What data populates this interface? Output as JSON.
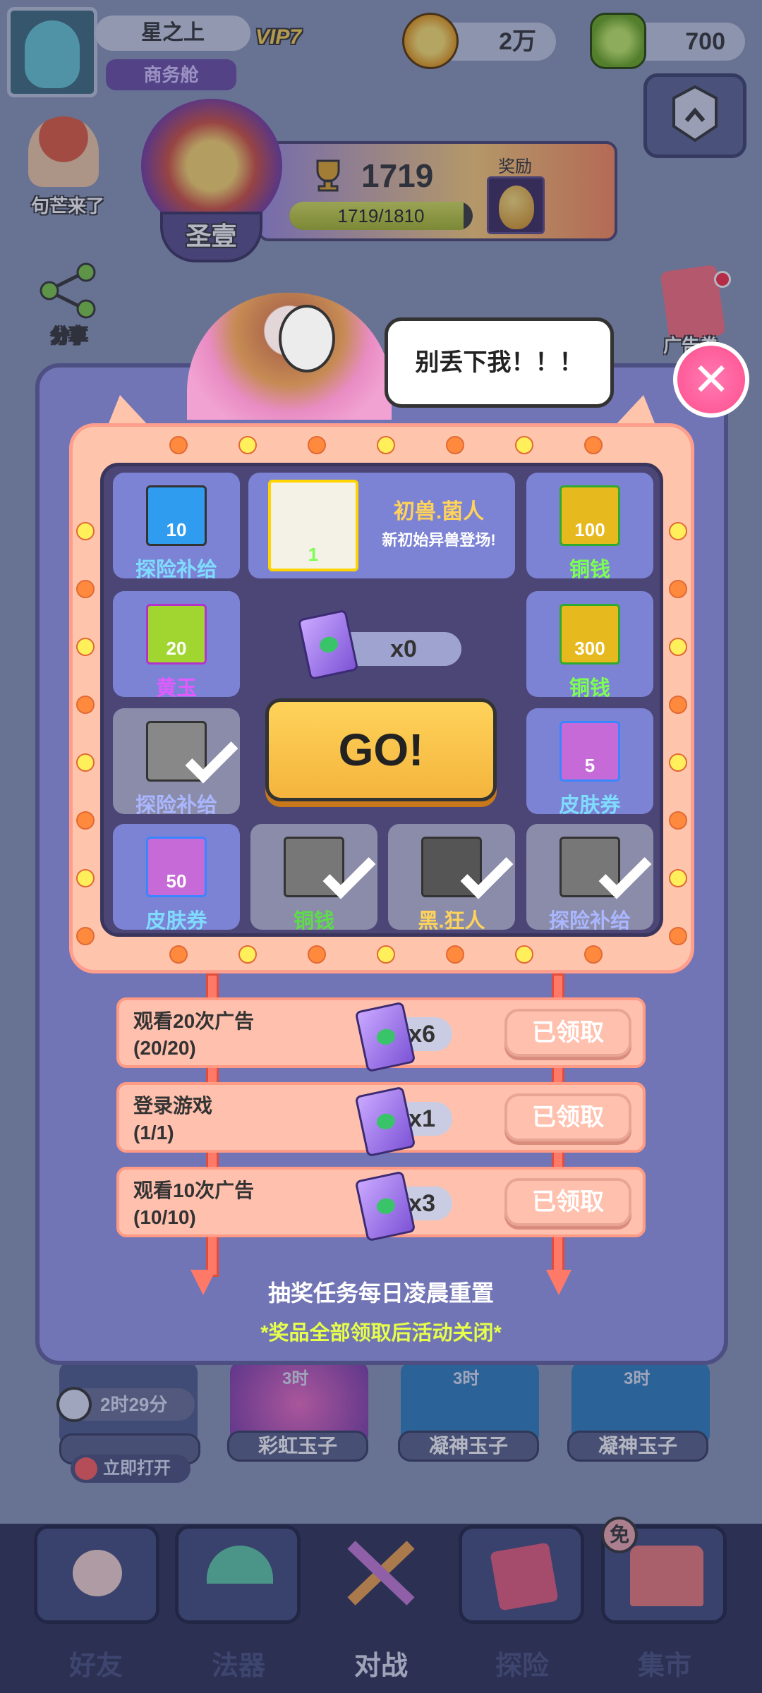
{
  "player": {
    "name": "星之上",
    "vip": "VIP7",
    "title": "商务舱"
  },
  "resources": {
    "coins": "2万",
    "jade": "700"
  },
  "rank": {
    "score": "1719",
    "progress_text": "1719/1810",
    "progress_fraction": 0.95,
    "reward_label": "奖励",
    "rank_name": "圣壹"
  },
  "side_left": [
    {
      "label": "句芒来了"
    },
    {
      "label": "分享"
    }
  ],
  "side_right": {
    "label": "广告卷"
  },
  "speech": "别丢下我！！！",
  "board": {
    "featured": {
      "name": "初兽.菌人",
      "desc": "新初始异兽登场!",
      "count": "1"
    },
    "tickets": "x0",
    "go_label": "GO!",
    "cells": [
      {
        "label": "探险补给",
        "count": "10",
        "claimed": false,
        "color": "#2f9cf0"
      },
      {
        "label": "铜钱",
        "count": "100",
        "claimed": false,
        "color": "#e6b91f"
      },
      {
        "label": "黄玉",
        "count": "20",
        "claimed": false,
        "color": "#a1d630"
      },
      {
        "label": "铜钱",
        "count": "300",
        "claimed": false,
        "color": "#e6b91f"
      },
      {
        "label": "探险补给",
        "count": "",
        "claimed": true,
        "color": "#888888"
      },
      {
        "label": "皮肤券",
        "count": "5",
        "claimed": false,
        "color": "#c66ad7"
      },
      {
        "label": "皮肤券",
        "count": "50",
        "claimed": false,
        "color": "#c66ad7"
      },
      {
        "label": "铜钱",
        "count": "",
        "claimed": true,
        "color": "#888888"
      },
      {
        "label": "黑.狂人",
        "count": "",
        "claimed": true,
        "color": "#666666"
      },
      {
        "label": "探险补给",
        "count": "",
        "claimed": true,
        "color": "#888888"
      }
    ]
  },
  "tasks": [
    {
      "title": "观看20次广告",
      "progress": "(20/20)",
      "reward": "x6",
      "button": "已领取"
    },
    {
      "title": "登录游戏",
      "progress": "(1/1)",
      "reward": "x1",
      "button": "已领取"
    },
    {
      "title": "观看10次广告",
      "progress": "(10/10)",
      "reward": "x3",
      "button": "已领取"
    }
  ],
  "footer": {
    "note": "抽奖任务每日凌晨重置",
    "warning": "*奖品全部领取后活动关闭*"
  },
  "eggs": {
    "timer": "2时29分",
    "open_now": "立即打开",
    "slots": [
      {
        "label": "彩虹玉子",
        "time": "3时"
      },
      {
        "label": "凝神玉子",
        "time": "3时"
      },
      {
        "label": "凝神玉子",
        "time": "3时"
      }
    ]
  },
  "nav": [
    {
      "label": "好友"
    },
    {
      "label": "法器"
    },
    {
      "label": "对战"
    },
    {
      "label": "探险"
    },
    {
      "label": "集市"
    }
  ],
  "nav_badge": "免",
  "colors": {
    "accent": "#f4b43d",
    "cell_label_active": "#7dff52",
    "panel": "#7275b5"
  }
}
